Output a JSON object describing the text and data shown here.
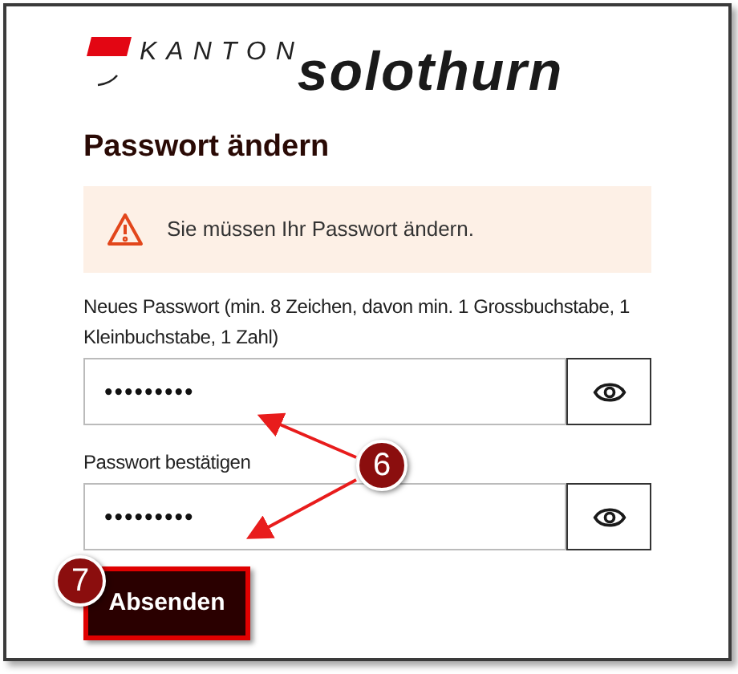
{
  "logo": {
    "prefix": "KANTON",
    "name": "solothurn"
  },
  "title": "Passwort ändern",
  "warning": {
    "text": "Sie müssen Ihr Passwort ändern."
  },
  "fields": [
    {
      "label": "Neues Passwort (min. 8 Zeichen, davon min. 1 Grossbuchstabe, 1 Kleinbuchstabe, 1 Zahl)",
      "value": "•••••••••"
    },
    {
      "label": "Passwort bestätigen",
      "value": "•••••••••"
    }
  ],
  "submit": {
    "label": "Absenden"
  },
  "annotations": [
    {
      "number": "6"
    },
    {
      "number": "7"
    }
  ]
}
